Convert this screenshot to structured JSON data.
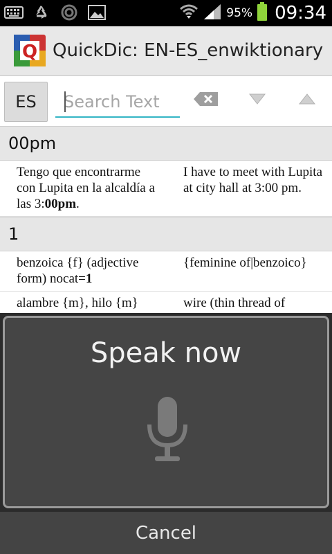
{
  "status_bar": {
    "icons_left": [
      "keyboard-icon",
      "recycle-icon",
      "sync-icon",
      "image-icon"
    ],
    "icons_right": [
      "wifi-icon",
      "signal-icon",
      "battery-icon"
    ],
    "battery_percent": "95%",
    "time": "09:34"
  },
  "app": {
    "title": "QuickDic: EN-ES_enwiktionary",
    "logo_letter": "Q"
  },
  "search": {
    "lang_button": "ES",
    "placeholder": "Search Text",
    "value": ""
  },
  "list": {
    "sections": [
      {
        "header": "00pm",
        "entries": [
          {
            "left_pre": "Tengo que encontrarme con Lupita en la alcaldía a las 3:",
            "left_bold": "00pm",
            "left_post": ".",
            "right": "I have to meet with Lupita at city hall at 3:00 pm."
          }
        ]
      },
      {
        "header": "1",
        "entries": [
          {
            "left_pre": "benzoica {f} (adjective form) nocat=",
            "left_bold": "1",
            "left_post": "",
            "right": "{feminine of|benzoico}"
          },
          {
            "left_pre": "alambre {m}, hilo {m}",
            "left_bold": "",
            "left_post": "",
            "right": "wire (thin thread of"
          }
        ]
      }
    ]
  },
  "voice_dialog": {
    "prompt": "Speak now",
    "cancel_label": "Cancel"
  },
  "colors": {
    "accent": "#33b5c5",
    "title_bar": "#e8e8e8",
    "dialog_bg": "#454545"
  }
}
